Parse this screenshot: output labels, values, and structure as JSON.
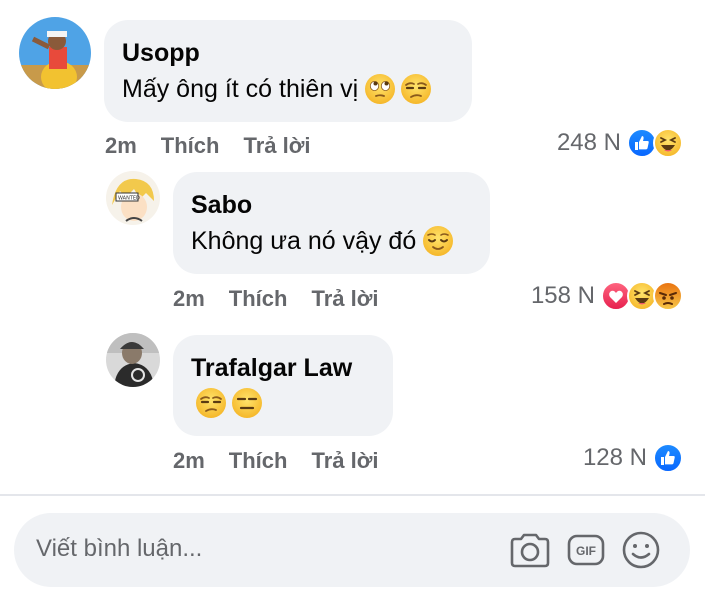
{
  "comments": [
    {
      "author": "Usopp",
      "text": "Mấy ông ít có thiên vị",
      "emojis": [
        "face-with-rolling-eyes",
        "unamused-face"
      ],
      "time": "2m",
      "like_label": "Thích",
      "reply_label": "Trả lời",
      "reaction_count": "248 N",
      "reactions": [
        "like-icon",
        "haha-icon"
      ]
    },
    {
      "author": "Sabo",
      "text": "Không ưa nó vậy đó",
      "emojis": [
        "relieved-face"
      ],
      "time": "2m",
      "like_label": "Thích",
      "reply_label": "Trả lời",
      "reaction_count": "158 N",
      "reactions": [
        "love-icon",
        "haha-icon",
        "angry-icon"
      ]
    },
    {
      "author": "Trafalgar Law",
      "text": "",
      "emojis": [
        "unamused-face",
        "expressionless-face"
      ],
      "time": "2m",
      "like_label": "Thích",
      "reply_label": "Trả lời",
      "reaction_count": "128 N",
      "reactions": [
        "like-icon"
      ]
    }
  ],
  "composer": {
    "placeholder": "Viết bình luận...",
    "tools": [
      "camera-icon",
      "gif-icon",
      "emoji-icon"
    ],
    "gif_label": "GIF"
  },
  "colors": {
    "bubble": "#f0f2f5",
    "meta_text": "#65676b",
    "like_blue": "#1877f2",
    "love_red": "#f33e58",
    "emoji_yellow": "#f7d04a"
  }
}
